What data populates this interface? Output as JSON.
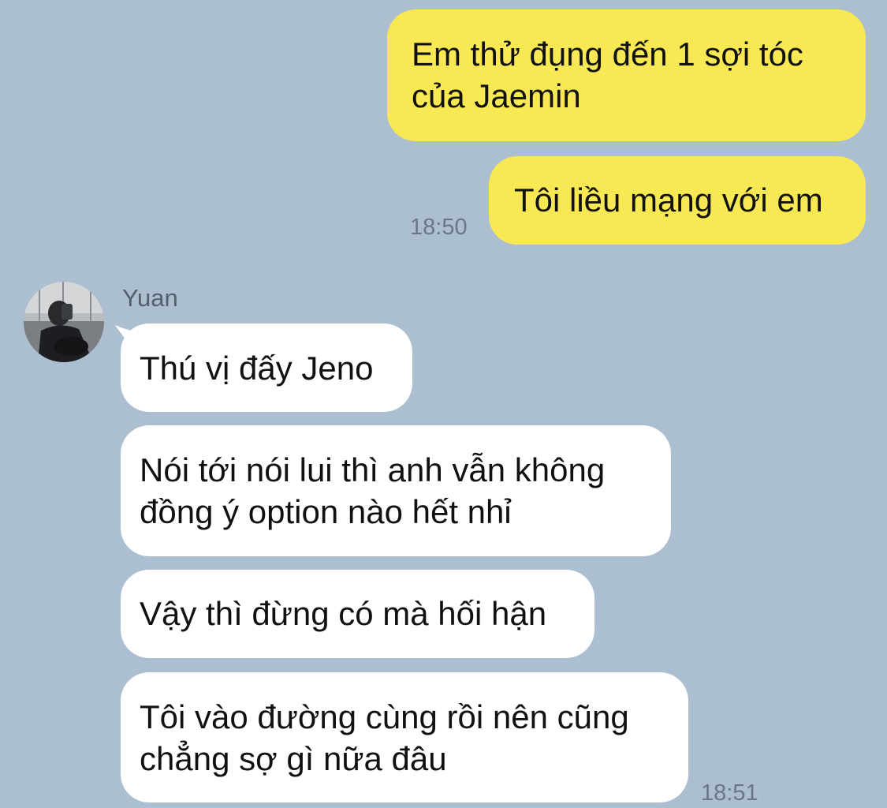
{
  "messages_outgoing": [
    {
      "line1": "Em thử đụng đến 1 sợi tóc",
      "line2": "của Jaemin"
    },
    {
      "text": "Tôi liều mạng với em",
      "time": "18:50"
    }
  ],
  "incoming": {
    "sender": "Yuan",
    "messages": [
      {
        "text": "Thú vị đấy Jeno"
      },
      {
        "line1": "Nói tới nói lui thì anh vẫn không",
        "line2": "đồng ý option nào hết nhỉ"
      },
      {
        "text": "Vậy thì đừng có mà hối hận"
      },
      {
        "line1": "Tôi vào đường cùng rồi nên cũng",
        "line2": "chẳng sợ gì nữa đâu",
        "time": "18:51"
      }
    ]
  },
  "colors": {
    "background": "#abbfd0",
    "outgoing_bubble": "#f8e854",
    "incoming_bubble": "#ffffff"
  },
  "icons": {
    "avatar": "user-avatar-photo"
  }
}
